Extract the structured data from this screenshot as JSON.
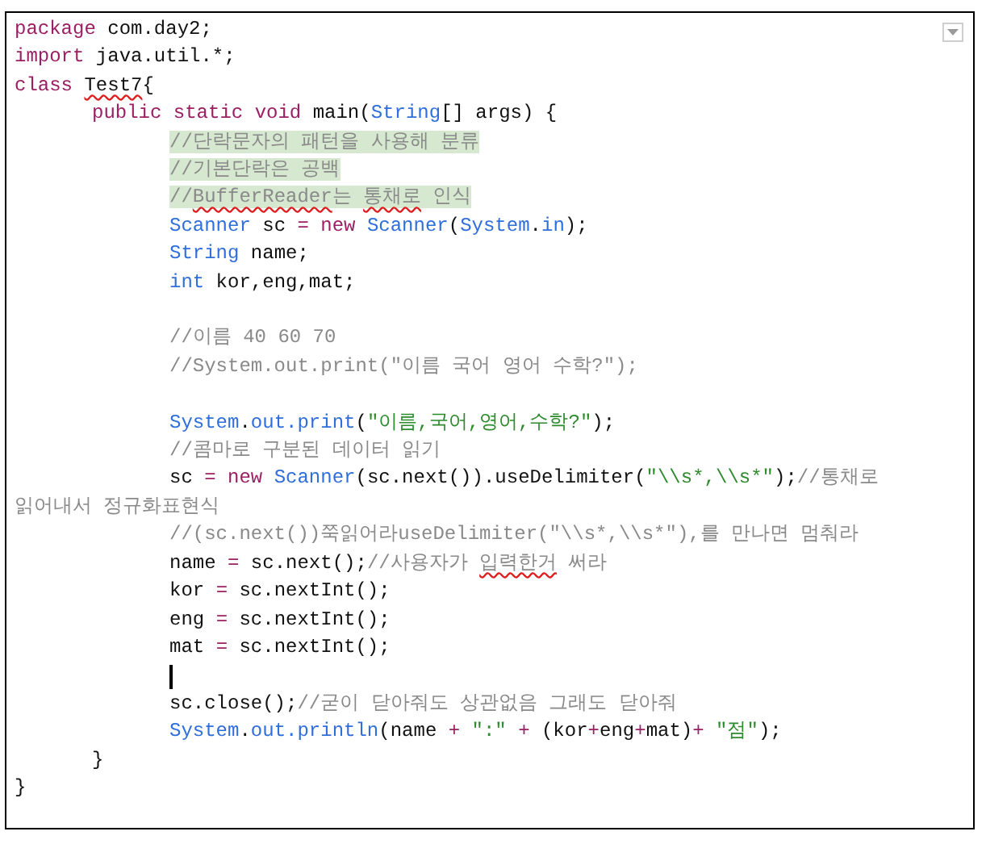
{
  "editor": {
    "lines": [
      {
        "kind": "code",
        "segments": [
          {
            "kind": "keyword",
            "text": "package"
          },
          {
            "kind": "plain",
            "text": " com.day2;"
          }
        ]
      },
      {
        "kind": "code",
        "segments": [
          {
            "kind": "keyword",
            "text": "import"
          },
          {
            "kind": "plain",
            "text": " java.util.*;"
          }
        ]
      },
      {
        "kind": "code",
        "segments": [
          {
            "kind": "keyword",
            "text": "class "
          },
          {
            "kind": "plain",
            "text": "Test7",
            "misspelled": true
          },
          {
            "kind": "plain",
            "text": "{"
          }
        ],
        "children": [
          {
            "kind": "code",
            "segments": [
              {
                "kind": "keyword",
                "text": "public static void"
              },
              {
                "kind": "plain",
                "text": " main("
              },
              {
                "kind": "type",
                "text": "String"
              },
              {
                "kind": "plain",
                "text": "[] args) {"
              }
            ],
            "children": [
              {
                "kind": "code",
                "segments": [
                  {
                    "kind": "comment",
                    "text": "//단락문자의 패턴을 사용해 분류",
                    "highlighted": true
                  }
                ]
              },
              {
                "kind": "code",
                "segments": [
                  {
                    "kind": "comment",
                    "text": "//기본단락은 공백",
                    "highlighted": true
                  }
                ]
              },
              {
                "kind": "code",
                "segments": [
                  {
                    "kind": "comment",
                    "text": "//",
                    "highlighted": true
                  },
                  {
                    "kind": "comment",
                    "text": "BufferReader",
                    "highlighted": true,
                    "misspelled": true
                  },
                  {
                    "kind": "comment",
                    "text": "는 ",
                    "highlighted": true
                  },
                  {
                    "kind": "comment",
                    "text": "통채로",
                    "highlighted": true,
                    "misspelled": true
                  },
                  {
                    "kind": "comment",
                    "text": " 인식",
                    "highlighted": true
                  }
                ]
              },
              {
                "kind": "code",
                "segments": [
                  {
                    "kind": "type",
                    "text": "Scanner"
                  },
                  {
                    "kind": "plain",
                    "text": " sc "
                  },
                  {
                    "kind": "operator",
                    "text": "= "
                  },
                  {
                    "kind": "keyword",
                    "text": "new "
                  },
                  {
                    "kind": "type",
                    "text": "Scanner"
                  },
                  {
                    "kind": "plain",
                    "text": "("
                  },
                  {
                    "kind": "type",
                    "text": "System"
                  },
                  {
                    "kind": "plain",
                    "text": "."
                  },
                  {
                    "kind": "type",
                    "text": "in"
                  },
                  {
                    "kind": "plain",
                    "text": ");"
                  }
                ]
              },
              {
                "kind": "code",
                "segments": [
                  {
                    "kind": "type",
                    "text": "String"
                  },
                  {
                    "kind": "plain",
                    "text": " name;"
                  }
                ]
              },
              {
                "kind": "code",
                "segments": [
                  {
                    "kind": "type",
                    "text": "int"
                  },
                  {
                    "kind": "plain",
                    "text": " kor,eng,mat;"
                  }
                ]
              },
              {
                "kind": "blank"
              },
              {
                "kind": "code",
                "segments": [
                  {
                    "kind": "comment",
                    "text": "//이름 40 60 70"
                  }
                ]
              },
              {
                "kind": "code",
                "segments": [
                  {
                    "kind": "comment",
                    "text": "//System.out.print(\"이름 국어 영어 수학?\");"
                  }
                ]
              },
              {
                "kind": "blank"
              },
              {
                "kind": "code",
                "segments": [
                  {
                    "kind": "type",
                    "text": "System"
                  },
                  {
                    "kind": "plain",
                    "text": "."
                  },
                  {
                    "kind": "type",
                    "text": "out.print"
                  },
                  {
                    "kind": "plain",
                    "text": "("
                  },
                  {
                    "kind": "string",
                    "text": "\"이름,국어,영어,수학?\""
                  },
                  {
                    "kind": "plain",
                    "text": ");"
                  }
                ]
              },
              {
                "kind": "code",
                "segments": [
                  {
                    "kind": "comment",
                    "text": "//콤마로 구분된 데이터 읽기"
                  }
                ]
              },
              {
                "kind": "code",
                "segments": [
                  {
                    "kind": "plain",
                    "text": "sc "
                  },
                  {
                    "kind": "operator",
                    "text": "= "
                  },
                  {
                    "kind": "keyword",
                    "text": "new "
                  },
                  {
                    "kind": "type",
                    "text": "Scanner"
                  },
                  {
                    "kind": "plain",
                    "text": "(sc.next()).useDelimiter("
                  },
                  {
                    "kind": "string",
                    "text": "\"\\\\s*,\\\\s*\""
                  },
                  {
                    "kind": "plain",
                    "text": ");"
                  },
                  {
                    "kind": "comment",
                    "text": "//통채로 읽어내서 정규화표현식"
                  }
                ]
              },
              {
                "kind": "code",
                "segments": [
                  {
                    "kind": "comment",
                    "text": "//(sc.next())쭉읽어라useDelimiter(\"\\\\s*,\\\\s*\"),를 만나면 멈춰라"
                  }
                ]
              },
              {
                "kind": "code",
                "segments": [
                  {
                    "kind": "plain",
                    "text": "name "
                  },
                  {
                    "kind": "operator",
                    "text": "="
                  },
                  {
                    "kind": "plain",
                    "text": " sc.next();"
                  },
                  {
                    "kind": "comment",
                    "text": "//사용자가 "
                  },
                  {
                    "kind": "comment",
                    "text": "입력한거",
                    "misspelled": true
                  },
                  {
                    "kind": "comment",
                    "text": " 써라"
                  }
                ]
              },
              {
                "kind": "code",
                "segments": [
                  {
                    "kind": "plain",
                    "text": "kor "
                  },
                  {
                    "kind": "operator",
                    "text": "="
                  },
                  {
                    "kind": "plain",
                    "text": " sc.nextInt();"
                  }
                ]
              },
              {
                "kind": "code",
                "segments": [
                  {
                    "kind": "plain",
                    "text": "eng "
                  },
                  {
                    "kind": "operator",
                    "text": "="
                  },
                  {
                    "kind": "plain",
                    "text": " sc.nextInt();"
                  }
                ]
              },
              {
                "kind": "code",
                "segments": [
                  {
                    "kind": "plain",
                    "text": "mat "
                  },
                  {
                    "kind": "operator",
                    "text": "="
                  },
                  {
                    "kind": "plain",
                    "text": " sc.nextInt();"
                  }
                ]
              },
              {
                "kind": "caret"
              },
              {
                "kind": "code",
                "segments": [
                  {
                    "kind": "plain",
                    "text": "sc.close();"
                  },
                  {
                    "kind": "comment",
                    "text": "//굳이 닫아줘도 상관없음 그래도 닫아줘"
                  }
                ]
              },
              {
                "kind": "code",
                "segments": [
                  {
                    "kind": "type",
                    "text": "System"
                  },
                  {
                    "kind": "plain",
                    "text": "."
                  },
                  {
                    "kind": "type",
                    "text": "out.println"
                  },
                  {
                    "kind": "plain",
                    "text": "(name "
                  },
                  {
                    "kind": "operator",
                    "text": "+ "
                  },
                  {
                    "kind": "string",
                    "text": "\":\" "
                  },
                  {
                    "kind": "operator",
                    "text": "+"
                  },
                  {
                    "kind": "plain",
                    "text": " (kor"
                  },
                  {
                    "kind": "operator",
                    "text": "+"
                  },
                  {
                    "kind": "plain",
                    "text": "eng"
                  },
                  {
                    "kind": "operator",
                    "text": "+"
                  },
                  {
                    "kind": "plain",
                    "text": "mat)"
                  },
                  {
                    "kind": "operator",
                    "text": "+ "
                  },
                  {
                    "kind": "string",
                    "text": "\"점\""
                  },
                  {
                    "kind": "plain",
                    "text": ");"
                  }
                ]
              }
            ]
          },
          {
            "kind": "code",
            "segments": [
              {
                "kind": "plain",
                "text": "}"
              }
            ]
          }
        ]
      },
      {
        "kind": "code",
        "segments": [
          {
            "kind": "plain",
            "text": "}"
          }
        ]
      }
    ]
  }
}
